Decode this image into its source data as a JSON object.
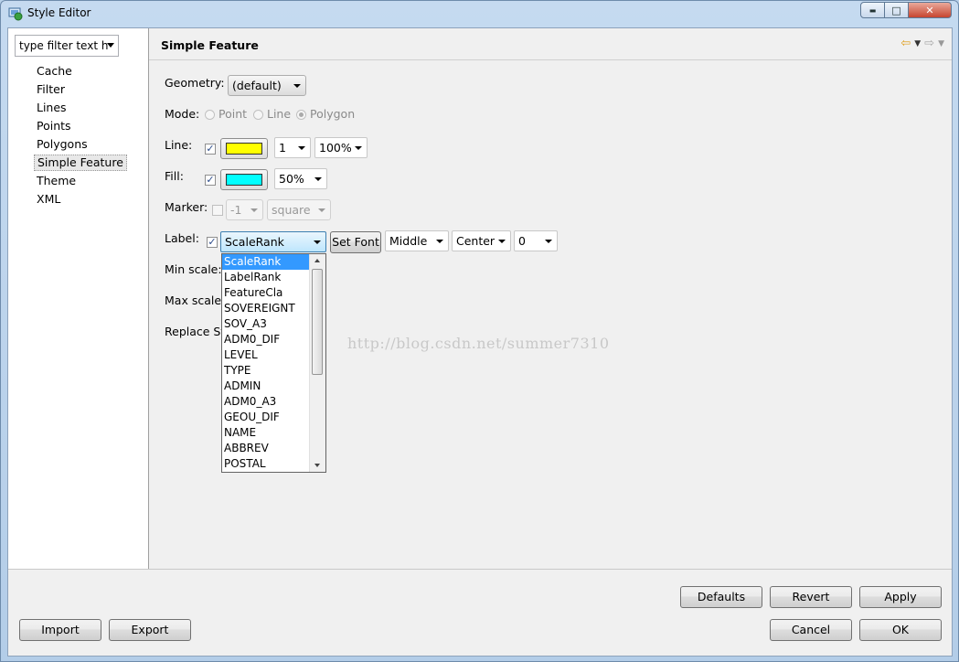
{
  "window": {
    "title": "Style Editor"
  },
  "window_buttons": {
    "minimize": "▬",
    "maximize": "□",
    "close": "✕"
  },
  "left": {
    "filter_placeholder": "type filter text h",
    "items": [
      "Cache",
      "Filter",
      "Lines",
      "Points",
      "Polygons",
      "Simple Feature",
      "Theme",
      "XML"
    ],
    "selected": "Simple Feature"
  },
  "page": {
    "title": "Simple Feature",
    "geometry_label": "Geometry:",
    "geometry_value": "(default)",
    "mode_label": "Mode:",
    "mode_options": [
      "Point",
      "Line",
      "Polygon"
    ],
    "mode_selected": "Polygon",
    "line_label": "Line:",
    "line_color": "#ffff00",
    "line_width": "1",
    "line_opacity": "100%",
    "fill_label": "Fill:",
    "fill_color": "#00ffff",
    "fill_opacity": "50%",
    "marker_label": "Marker:",
    "marker_size": "-1",
    "marker_shape": "square",
    "label_label": "Label:",
    "label_field": "ScaleRank",
    "set_font": "Set Font",
    "label_vertical": "Middle",
    "label_horizontal": "Center",
    "label_rotation": "0",
    "min_scale_label": "Min scale:",
    "max_scale_label": "Max scale:",
    "replace_label": "Replace St"
  },
  "dropdown": {
    "options": [
      "ScaleRank",
      "LabelRank",
      "FeatureCla",
      "SOVEREIGNT",
      "SOV_A3",
      "ADM0_DIF",
      "LEVEL",
      "TYPE",
      "ADMIN",
      "ADM0_A3",
      "GEOU_DIF",
      "NAME",
      "ABBREV",
      "POSTAL"
    ],
    "selected": "ScaleRank"
  },
  "watermark": "http://blog.csdn.net/summer7310",
  "buttons": {
    "defaults": "Defaults",
    "revert": "Revert",
    "apply": "Apply",
    "import": "Import",
    "export": "Export",
    "cancel": "Cancel",
    "ok": "OK"
  }
}
